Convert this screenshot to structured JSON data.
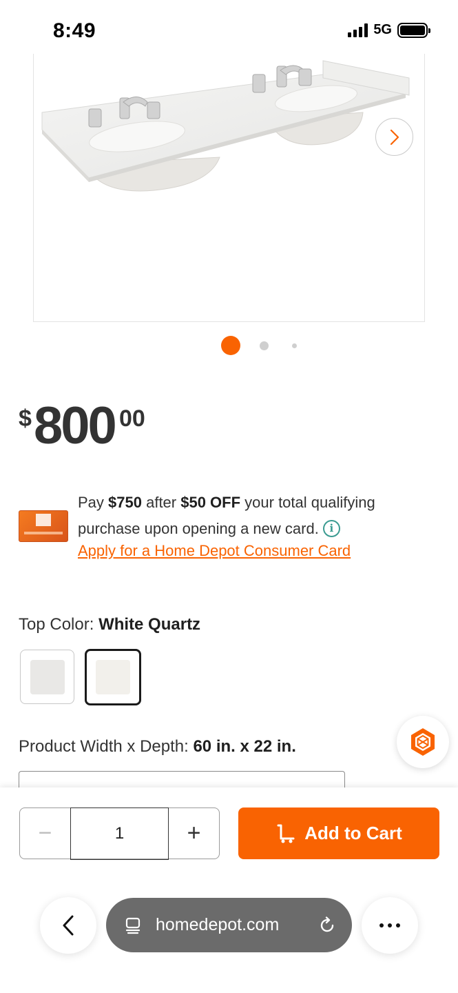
{
  "status_bar": {
    "time": "8:49",
    "network": "5G"
  },
  "product": {
    "image_icon": "double-vanity-top-image",
    "carousel": {
      "current": 1,
      "total": 3
    }
  },
  "price": {
    "currency": "$",
    "dollars": "800",
    "cents": "00"
  },
  "credit_offer": {
    "text_pay": "Pay ",
    "amount": "$750",
    "text_after": " after ",
    "discount": "$50 OFF",
    "text_rest": " your total qualifying purchase upon opening a new card.",
    "apply_link": "Apply for a Home Depot Consumer Card"
  },
  "top_color": {
    "label": "Top Color: ",
    "value": "White Quartz",
    "swatches": [
      {
        "name": "light-gray",
        "color": "#e9e8e6",
        "selected": false
      },
      {
        "name": "white-quartz",
        "color": "#f2f0eb",
        "selected": true
      }
    ]
  },
  "dimensions": {
    "label": "Product Width x Depth: ",
    "value": "60 in. x 22 in."
  },
  "cart_bar": {
    "quantity": "1",
    "minus": "−",
    "plus": "+",
    "add_to_cart": "Add to Cart"
  },
  "browser": {
    "url": "homedepot.com"
  },
  "colors": {
    "brand_orange": "#f96302",
    "info_teal": "#3b9b91"
  }
}
